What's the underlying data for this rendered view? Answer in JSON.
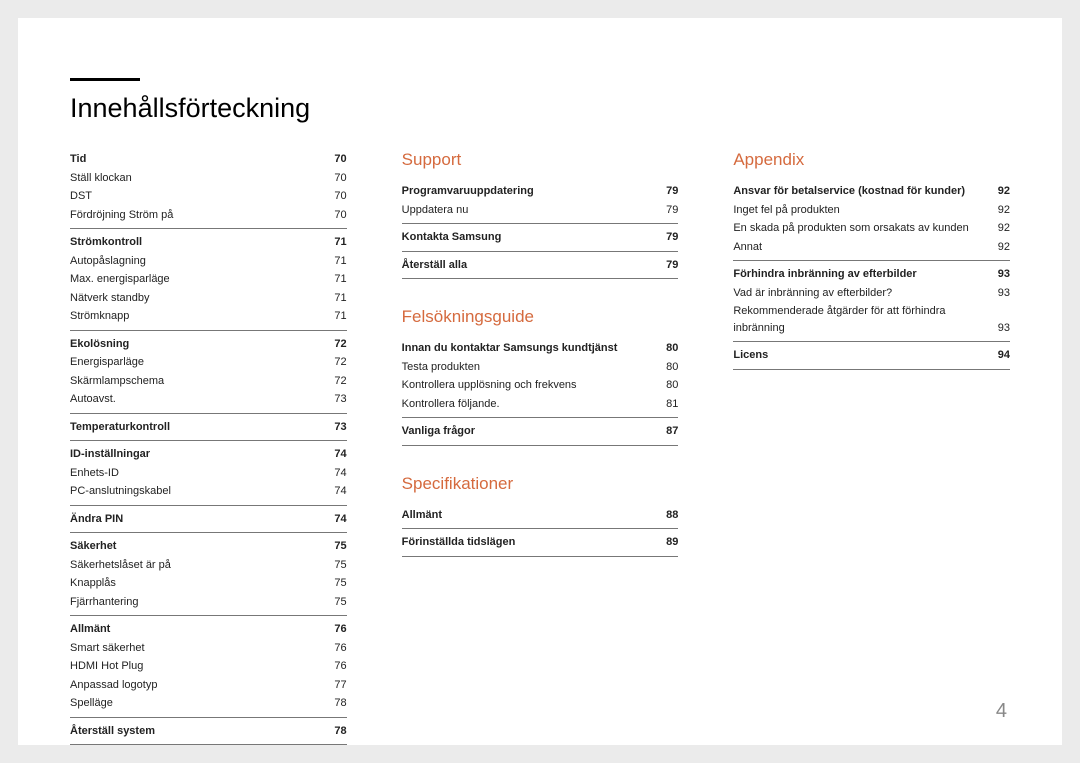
{
  "title": "Innehållsförteckning",
  "pageNumber": "4",
  "columns": [
    {
      "chapters": [
        {
          "heading": null,
          "groups": [
            {
              "rows": [
                {
                  "label": "Tid",
                  "page": "70",
                  "bold": true
                },
                {
                  "label": "Ställ klockan",
                  "page": "70",
                  "bold": false
                },
                {
                  "label": "DST",
                  "page": "70",
                  "bold": false
                },
                {
                  "label": "Fördröjning Ström på",
                  "page": "70",
                  "bold": false
                }
              ]
            },
            {
              "rows": [
                {
                  "label": "Strömkontroll",
                  "page": "71",
                  "bold": true
                },
                {
                  "label": "Autopåslagning",
                  "page": "71",
                  "bold": false
                },
                {
                  "label": "Max. energisparläge",
                  "page": "71",
                  "bold": false
                },
                {
                  "label": "Nätverk standby",
                  "page": "71",
                  "bold": false
                },
                {
                  "label": "Strömknapp",
                  "page": "71",
                  "bold": false
                }
              ]
            },
            {
              "rows": [
                {
                  "label": "Ekolösning",
                  "page": "72",
                  "bold": true
                },
                {
                  "label": "Energisparläge",
                  "page": "72",
                  "bold": false
                },
                {
                  "label": "Skärmlampschema",
                  "page": "72",
                  "bold": false
                },
                {
                  "label": "Autoavst.",
                  "page": "73",
                  "bold": false
                }
              ]
            },
            {
              "rows": [
                {
                  "label": "Temperaturkontroll",
                  "page": "73",
                  "bold": true
                }
              ]
            },
            {
              "rows": [
                {
                  "label": "ID-inställningar",
                  "page": "74",
                  "bold": true
                },
                {
                  "label": "Enhets-ID",
                  "page": "74",
                  "bold": false
                },
                {
                  "label": "PC-anslutningskabel",
                  "page": "74",
                  "bold": false
                }
              ]
            },
            {
              "rows": [
                {
                  "label": "Ändra PIN",
                  "page": "74",
                  "bold": true
                }
              ]
            },
            {
              "rows": [
                {
                  "label": "Säkerhet",
                  "page": "75",
                  "bold": true
                },
                {
                  "label": "Säkerhetslåset är på",
                  "page": "75",
                  "bold": false
                },
                {
                  "label": "Knapplås",
                  "page": "75",
                  "bold": false
                },
                {
                  "label": "Fjärrhantering",
                  "page": "75",
                  "bold": false
                }
              ]
            },
            {
              "rows": [
                {
                  "label": "Allmänt",
                  "page": "76",
                  "bold": true
                },
                {
                  "label": "Smart säkerhet",
                  "page": "76",
                  "bold": false
                },
                {
                  "label": "HDMI Hot Plug",
                  "page": "76",
                  "bold": false
                },
                {
                  "label": "Anpassad logotyp",
                  "page": "77",
                  "bold": false
                },
                {
                  "label": "Spelläge",
                  "page": "78",
                  "bold": false
                }
              ]
            },
            {
              "rows": [
                {
                  "label": "Återställ system",
                  "page": "78",
                  "bold": true
                }
              ]
            }
          ]
        }
      ]
    },
    {
      "chapters": [
        {
          "heading": "Support",
          "groups": [
            {
              "rows": [
                {
                  "label": "Programvaruuppdatering",
                  "page": "79",
                  "bold": true
                },
                {
                  "label": "Uppdatera nu",
                  "page": "79",
                  "bold": false
                }
              ]
            },
            {
              "rows": [
                {
                  "label": "Kontakta Samsung",
                  "page": "79",
                  "bold": true
                }
              ]
            },
            {
              "rows": [
                {
                  "label": "Återställ alla",
                  "page": "79",
                  "bold": true
                }
              ]
            }
          ]
        },
        {
          "heading": "Felsökningsguide",
          "groups": [
            {
              "rows": [
                {
                  "label": "Innan du kontaktar Samsungs kundtjänst",
                  "page": "80",
                  "bold": true
                },
                {
                  "label": "Testa produkten",
                  "page": "80",
                  "bold": false
                },
                {
                  "label": "Kontrollera upplösning och frekvens",
                  "page": "80",
                  "bold": false
                },
                {
                  "label": "Kontrollera följande.",
                  "page": "81",
                  "bold": false
                }
              ]
            },
            {
              "rows": [
                {
                  "label": "Vanliga frågor",
                  "page": "87",
                  "bold": true
                }
              ]
            }
          ]
        },
        {
          "heading": "Specifikationer",
          "groups": [
            {
              "rows": [
                {
                  "label": "Allmänt",
                  "page": "88",
                  "bold": true
                }
              ]
            },
            {
              "rows": [
                {
                  "label": "Förinställda tidslägen",
                  "page": "89",
                  "bold": true
                }
              ]
            }
          ]
        }
      ]
    },
    {
      "chapters": [
        {
          "heading": "Appendix",
          "groups": [
            {
              "rows": [
                {
                  "label": "Ansvar för betalservice (kostnad för kunder)",
                  "page": "92",
                  "bold": true
                },
                {
                  "label": "Inget fel på produkten",
                  "page": "92",
                  "bold": false
                },
                {
                  "label": "En skada på produkten som orsakats av kunden",
                  "page": "92",
                  "bold": false
                },
                {
                  "label": "Annat",
                  "page": "92",
                  "bold": false
                }
              ]
            },
            {
              "rows": [
                {
                  "label": "Förhindra inbränning av efterbilder",
                  "page": "93",
                  "bold": true
                },
                {
                  "label": "Vad är inbränning av efterbilder?",
                  "page": "93",
                  "bold": false
                },
                {
                  "label": "Rekommenderade åtgärder för att förhindra inbränning",
                  "page": "93",
                  "bold": false
                }
              ]
            },
            {
              "rows": [
                {
                  "label": "Licens",
                  "page": "94",
                  "bold": true
                }
              ]
            }
          ]
        }
      ]
    }
  ]
}
